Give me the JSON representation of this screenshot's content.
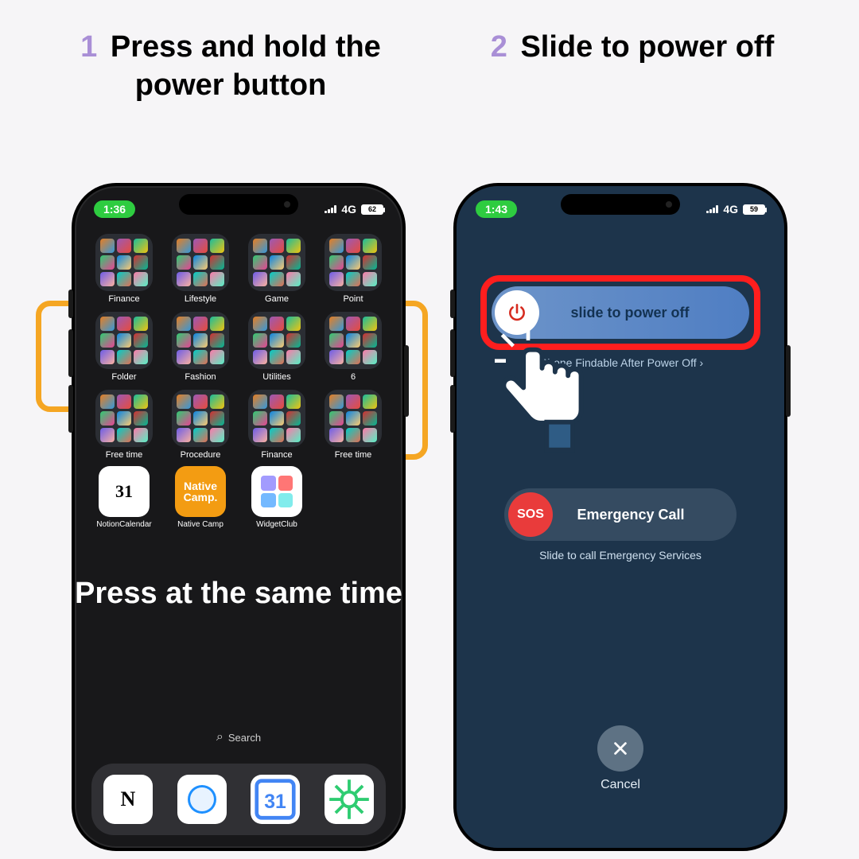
{
  "steps": [
    {
      "num": "1",
      "title": "Press and hold the power button"
    },
    {
      "num": "2",
      "title": "Slide to power off"
    }
  ],
  "phone_left": {
    "status": {
      "time": "1:36",
      "network": "4G",
      "battery": "62"
    },
    "overlay": "Press at the same time",
    "search_label": "Search",
    "folder_rows": [
      [
        "Finance",
        "Lifestyle",
        "Game",
        "Point"
      ],
      [
        "Folder",
        "Fashion",
        "Utilities",
        "6"
      ],
      [
        "Free time",
        "Procedure",
        "Finance",
        "Free time"
      ]
    ],
    "apps": [
      "NotionCalendar",
      "Native Camp",
      "WidgetClub"
    ]
  },
  "phone_right": {
    "status": {
      "time": "1:43",
      "network": "4G",
      "battery": "59"
    },
    "slider_label": "slide to power off",
    "findable": "iPhone Findable After Power Off ›",
    "sos_label": "Emergency Call",
    "sos_sub": "Slide to call Emergency Services",
    "cancel": "Cancel",
    "sos_short": "SOS"
  }
}
